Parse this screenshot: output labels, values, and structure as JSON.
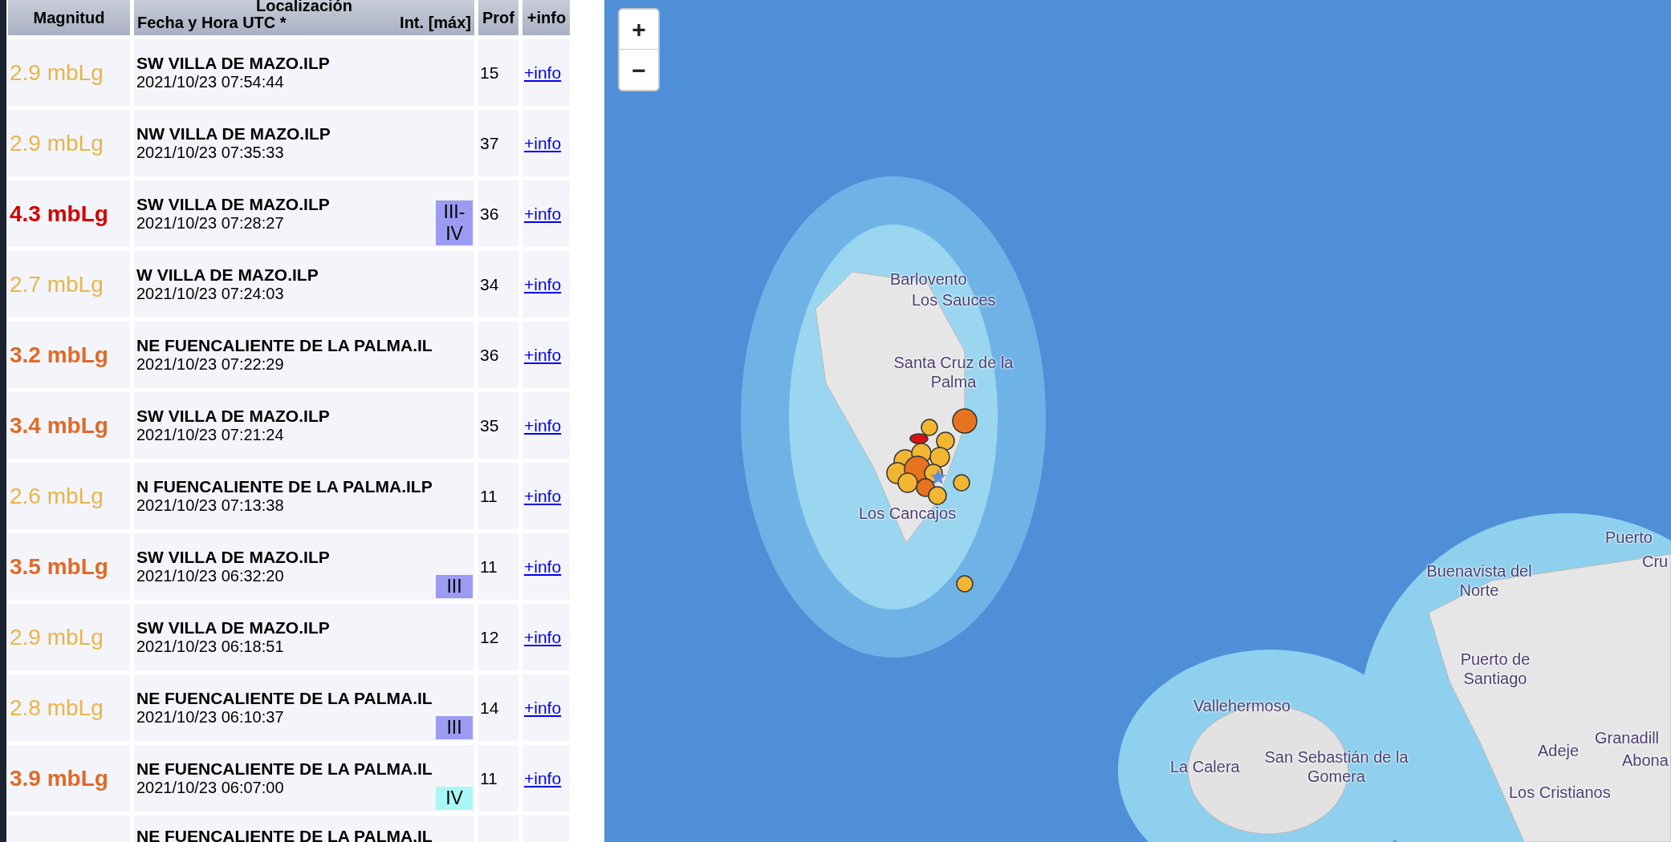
{
  "table": {
    "columns": {
      "magnitude": "Magnitud",
      "location": "Localización",
      "datetime": "Fecha y Hora UTC *",
      "intensity": "Int. [máx]",
      "depth": "Prof",
      "info": "+info"
    },
    "rows": [
      {
        "magnitude": "2.9 mbLg",
        "color": "#e8b548",
        "bold": false,
        "location": "SW VILLA DE MAZO.ILP",
        "datetime": "2021/10/23 07:54:44",
        "depth": "15",
        "link": "+info"
      },
      {
        "magnitude": "2.9 mbLg",
        "color": "#e8b548",
        "bold": false,
        "location": "NW VILLA DE MAZO.ILP",
        "datetime": "2021/10/23 07:35:33",
        "depth": "37",
        "link": "+info"
      },
      {
        "magnitude": "4.3 mbLg",
        "color": "#d40000",
        "bold": true,
        "location": "SW VILLA DE MAZO.ILP",
        "datetime": "2021/10/23 07:28:27",
        "intensity": {
          "text": "III-IV",
          "color": "#9b9bf2"
        },
        "depth": "36",
        "link": "+info"
      },
      {
        "magnitude": "2.7 mbLg",
        "color": "#e8b548",
        "bold": false,
        "location": "W VILLA DE MAZO.ILP",
        "datetime": "2021/10/23 07:24:03",
        "depth": "34",
        "link": "+info"
      },
      {
        "magnitude": "3.2 mbLg",
        "color": "#e06a27",
        "bold": true,
        "location": "NE FUENCALIENTE DE LA PALMA.IL",
        "datetime": "2021/10/23 07:22:29",
        "depth": "36",
        "link": "+info"
      },
      {
        "magnitude": "3.4 mbLg",
        "color": "#e06a27",
        "bold": true,
        "location": "SW VILLA DE MAZO.ILP",
        "datetime": "2021/10/23 07:21:24",
        "depth": "35",
        "link": "+info"
      },
      {
        "magnitude": "2.6 mbLg",
        "color": "#e8b548",
        "bold": false,
        "location": "N FUENCALIENTE DE LA PALMA.ILP",
        "datetime": "2021/10/23 07:13:38",
        "depth": "11",
        "link": "+info"
      },
      {
        "magnitude": "3.5 mbLg",
        "color": "#e06a27",
        "bold": true,
        "location": "SW VILLA DE MAZO.ILP",
        "datetime": "2021/10/23 06:32:20",
        "intensity": {
          "text": "III",
          "color": "#9b9bf2"
        },
        "depth": "11",
        "link": "+info"
      },
      {
        "magnitude": "2.9 mbLg",
        "color": "#e8b548",
        "bold": false,
        "location": "SW VILLA DE MAZO.ILP",
        "datetime": "2021/10/23 06:18:51",
        "depth": "12",
        "link": "+info"
      },
      {
        "magnitude": "2.8 mbLg",
        "color": "#e8b548",
        "bold": false,
        "location": "NE FUENCALIENTE DE LA PALMA.IL",
        "datetime": "2021/10/23 06:10:37",
        "intensity": {
          "text": "III",
          "color": "#9b9bf2"
        },
        "depth": "14",
        "link": "+info"
      },
      {
        "magnitude": "3.9 mbLg",
        "color": "#e06a27",
        "bold": true,
        "location": "NE FUENCALIENTE DE LA PALMA.IL",
        "datetime": "2021/10/23 06:07:00",
        "intensity": {
          "text": "IV",
          "color": "#aaf7f5"
        },
        "depth": "11",
        "link": "+info"
      },
      {
        "location": "NE FUENCALIENTE DE LA PALMA.IL"
      }
    ]
  },
  "map": {
    "zoom_controls": [
      "+",
      "−"
    ],
    "labels": [
      {
        "text": "Barlovento"
      },
      {
        "text": "Los Sauces"
      },
      {
        "text": "Santa Cruz de la Palma"
      },
      {
        "text": "Los Cancajos"
      },
      {
        "text": "Puerto"
      },
      {
        "text": "Cru"
      },
      {
        "text": "Buenavista del Norte"
      },
      {
        "text": "Puerto de Santiago"
      },
      {
        "text": "Vallehermoso"
      },
      {
        "text": "Granadill"
      },
      {
        "text": "La Calera"
      },
      {
        "text": "San Sebastián de la Gomera"
      },
      {
        "text": "Adeje"
      },
      {
        "text": "Abona"
      },
      {
        "text": "Los Cristianos"
      }
    ]
  }
}
